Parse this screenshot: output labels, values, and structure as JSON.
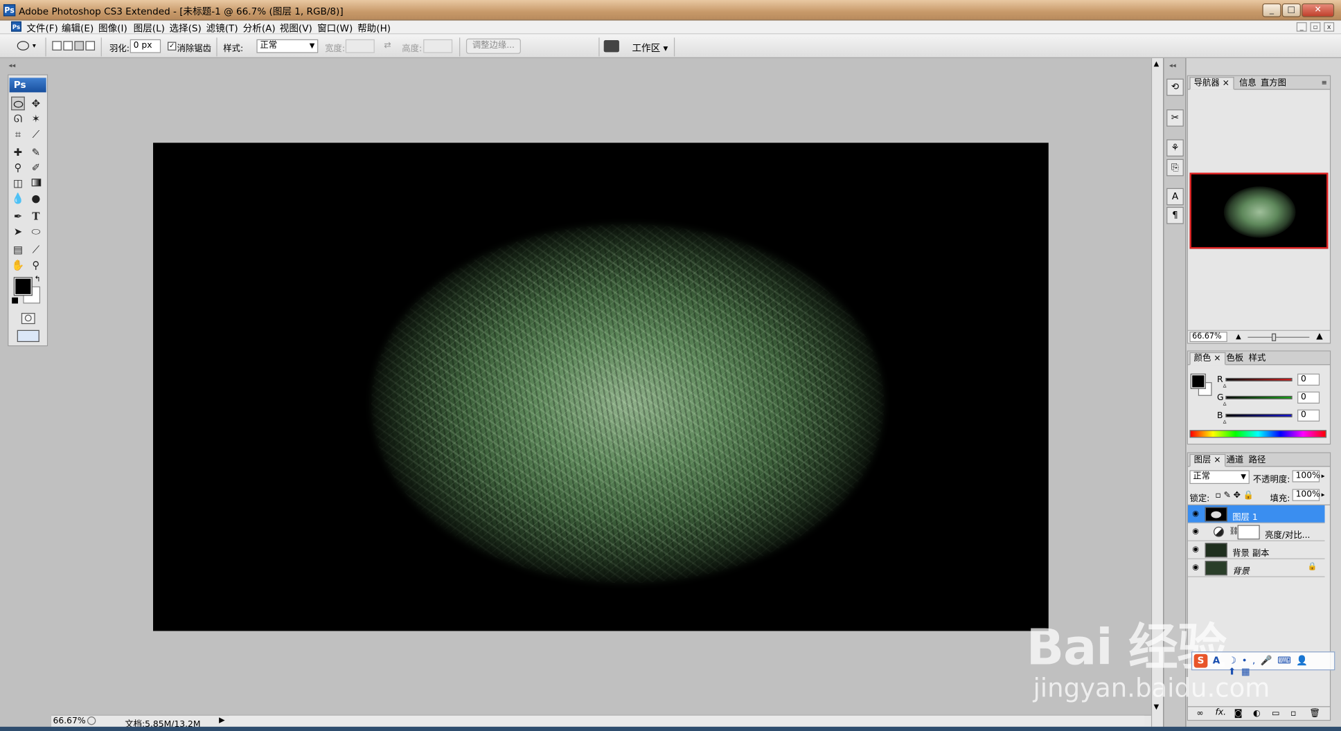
{
  "window": {
    "title": "Adobe Photoshop CS3 Extended - [未标题-1 @ 66.7% (图层 1, RGB/8)]",
    "app_icon": "Ps",
    "min": "_",
    "max": "□",
    "close": "✕"
  },
  "menubar": {
    "doc_icon": "Ps",
    "items": [
      "文件(F)",
      "编辑(E)",
      "图像(I)",
      "图层(L)",
      "选择(S)",
      "滤镜(T)",
      "分析(A)",
      "视图(V)",
      "窗口(W)",
      "帮助(H)"
    ]
  },
  "options": {
    "feather_label": "羽化:",
    "feather_value": "0 px",
    "antialias_label": "消除锯齿",
    "antialias_checked": true,
    "style_label": "样式:",
    "style_value": "正常",
    "width_label": "宽度:",
    "height_label": "高度:",
    "refine_edge": "调整边缘...",
    "workspace": "工作区 ▾"
  },
  "toolbox": {
    "badge": "Ps",
    "selected": "elliptical-marquee-tool",
    "foreground_color": "#000000",
    "background_color": "#ffffff"
  },
  "document": {
    "background_color": "#000000",
    "glow_color": "#8fb08a"
  },
  "status": {
    "zoom": "66.67%",
    "doc_size": "文档:5.85M/13.2M"
  },
  "navigator": {
    "tabs": [
      "导航器",
      "信息",
      "直方图"
    ],
    "zoom": "66.67%"
  },
  "color_panel": {
    "tabs": [
      "颜色",
      "色板",
      "样式"
    ],
    "channels": [
      {
        "label": "R",
        "value": "0",
        "color": "#d01010"
      },
      {
        "label": "G",
        "value": "0",
        "color": "#10a010"
      },
      {
        "label": "B",
        "value": "0",
        "color": "#1010d0"
      }
    ]
  },
  "layers_panel": {
    "tabs": [
      "图层",
      "通道",
      "路径"
    ],
    "blend_mode": "正常",
    "opacity_label": "不透明度:",
    "opacity": "100%",
    "lock_label": "锁定:",
    "fill_label": "填充:",
    "fill": "100%",
    "layers": [
      {
        "name": "图层 1",
        "selected": true
      },
      {
        "name": "亮度/对比...",
        "selected": false
      },
      {
        "name": "背景 副本",
        "selected": false
      },
      {
        "name": "背景",
        "selected": false,
        "locked": true
      }
    ],
    "footer_icons": [
      "link-icon",
      "fx-icon",
      "mask-icon",
      "adjustment-icon",
      "group-icon",
      "new-layer-icon",
      "trash-icon"
    ]
  },
  "watermark": {
    "main": "Bai 经验",
    "sub": "jingyan.baidu.com"
  },
  "ime": {
    "label": "A"
  }
}
